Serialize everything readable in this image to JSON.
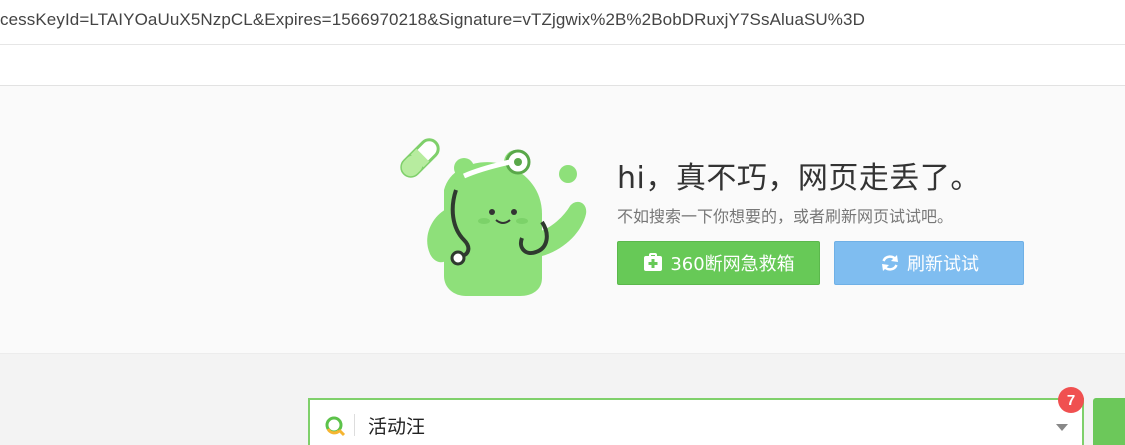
{
  "address_bar": {
    "url_text": "cessKeyId=LTAIYOaUuX5NzpCL&Expires=1566970218&Signature=vTZjgwix%2B%2BobDRuxjY7SsAluaSU%3D"
  },
  "error_page": {
    "headline": "hi，真不巧，网页走丢了。",
    "subline": "不如搜索一下你想要的，或者刷新网页试试吧。",
    "rescue_button_label": "360断网急救箱",
    "refresh_button_label": "刷新试试",
    "colors": {
      "rescue_button": "#67c957",
      "refresh_button": "#7fbdf0",
      "mascot": "#8ee07a"
    }
  },
  "search": {
    "value": "活动汪",
    "badge_count": "7",
    "accent_color": "#7fd06b"
  }
}
